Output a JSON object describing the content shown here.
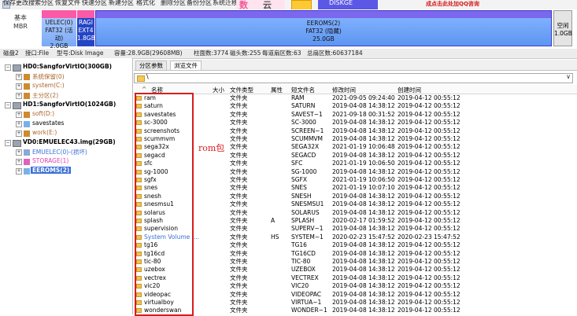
{
  "toolbar": {
    "items": [
      "保存更改",
      "搜索分区",
      "恢复文件",
      "快速分区",
      "新建分区",
      "格式化",
      "删除分区",
      "备份分区",
      "系统迁移"
    ],
    "banner_text": "数",
    "banner_text2": "云",
    "banner_text3": "DISKGE",
    "ad_text": "成点击此处加QQ咨询"
  },
  "diskmap": {
    "disk_label_1": "基本",
    "disk_label_2": "MBR",
    "partitions": [
      {
        "name": "UELEC(0)",
        "fs": "FAT32 (活动)",
        "size": "2.0GB"
      },
      {
        "name": "RAGI",
        "fs": "EXT4",
        "size": "1.8GB"
      },
      {
        "name": "EEROMS(2)",
        "fs": "FAT32 (隐藏)",
        "size": "25.0GB"
      },
      {
        "name": "空闲",
        "size": "1.0GB"
      }
    ]
  },
  "infobar": {
    "disk": "磁盘2",
    "interface": "接口:File",
    "model": "型号:Disk Image",
    "capacity": "容量:28.9GB(29608MB)",
    "cylinders": "柱面数:3774",
    "heads": "磁头数:255",
    "sectors_per_track": "每道扇区数:63",
    "total_sectors": "总扇区数:60637184"
  },
  "tree": {
    "disks": [
      {
        "label": "HD0:SangforVirtIO(300GB)",
        "parts": [
          "系统保留(0)",
          "system(C:)",
          "主分区(2)"
        ]
      },
      {
        "label": "HD1:SangforVirtIO(1024GB)",
        "parts": [
          "soft(D:)",
          "savestates",
          "work(E:)"
        ]
      },
      {
        "label": "VD0:EMUELEC43.img(29GB)",
        "parts": [
          "EMUELEC(0)-(损坏)",
          "STORAGE(1)",
          "EEROMS(2)"
        ]
      }
    ]
  },
  "tabs": [
    "分区参数",
    "浏览文件"
  ],
  "path": "\\",
  "columns": {
    "name": "名称",
    "size": "大小",
    "type": "文件类型",
    "attr": "属性",
    "short": "短文件名",
    "mtime": "修改时间",
    "ctime": "创建时间"
  },
  "files": [
    {
      "name": "ram",
      "type": "文件夹",
      "attr": "",
      "short": "RAM",
      "mtime": "2021-09-05 09:24:40",
      "ctime": "2019-04-12 00:55:12"
    },
    {
      "name": "saturn",
      "type": "文件夹",
      "attr": "",
      "short": "SATURN",
      "mtime": "2019-04-08 14:38:12",
      "ctime": "2019-04-12 00:55:12"
    },
    {
      "name": "savestates",
      "type": "文件夹",
      "attr": "",
      "short": "SAVEST~1",
      "mtime": "2021-09-18 00:31:52",
      "ctime": "2019-04-12 00:55:12"
    },
    {
      "name": "sc-3000",
      "type": "文件夹",
      "attr": "",
      "short": "SC-3000",
      "mtime": "2019-04-08 14:38:12",
      "ctime": "2019-04-12 00:55:12"
    },
    {
      "name": "screenshots",
      "type": "文件夹",
      "attr": "",
      "short": "SCREEN~1",
      "mtime": "2019-04-08 14:38:12",
      "ctime": "2019-04-12 00:55:12"
    },
    {
      "name": "scummvm",
      "type": "文件夹",
      "attr": "",
      "short": "SCUMMVM",
      "mtime": "2019-04-08 14:38:12",
      "ctime": "2019-04-12 00:55:12"
    },
    {
      "name": "sega32x",
      "type": "文件夹",
      "attr": "",
      "short": "SEGA32X",
      "mtime": "2021-01-19 10:06:48",
      "ctime": "2019-04-12 00:55:12"
    },
    {
      "name": "segacd",
      "type": "文件夹",
      "attr": "",
      "short": "SEGACD",
      "mtime": "2019-04-08 14:38:12",
      "ctime": "2019-04-12 00:55:12"
    },
    {
      "name": "sfc",
      "type": "文件夹",
      "attr": "",
      "short": "SFC",
      "mtime": "2021-01-19 10:06:50",
      "ctime": "2019-04-12 00:55:12"
    },
    {
      "name": "sg-1000",
      "type": "文件夹",
      "attr": "",
      "short": "SG-1000",
      "mtime": "2019-04-08 14:38:12",
      "ctime": "2019-04-12 00:55:12"
    },
    {
      "name": "sgfx",
      "type": "文件夹",
      "attr": "",
      "short": "SGFX",
      "mtime": "2021-01-19 10:06:50",
      "ctime": "2019-04-12 00:55:12"
    },
    {
      "name": "snes",
      "type": "文件夹",
      "attr": "",
      "short": "SNES",
      "mtime": "2021-01-19 10:07:10",
      "ctime": "2019-04-12 00:55:12"
    },
    {
      "name": "snesh",
      "type": "文件夹",
      "attr": "",
      "short": "SNESH",
      "mtime": "2019-04-08 14:38:12",
      "ctime": "2019-04-12 00:55:12"
    },
    {
      "name": "snesmsu1",
      "type": "文件夹",
      "attr": "",
      "short": "SNESMSU1",
      "mtime": "2019-04-08 14:38:12",
      "ctime": "2019-04-12 00:55:12"
    },
    {
      "name": "solarus",
      "type": "文件夹",
      "attr": "",
      "short": "SOLARUS",
      "mtime": "2019-04-08 14:38:12",
      "ctime": "2019-04-12 00:55:12"
    },
    {
      "name": "splash",
      "type": "文件夹",
      "attr": "A",
      "short": "SPLASH",
      "mtime": "2020-02-17 01:59:52",
      "ctime": "2019-04-12 00:55:12"
    },
    {
      "name": "supervision",
      "type": "文件夹",
      "attr": "",
      "short": "SUPERV~1",
      "mtime": "2019-04-08 14:38:12",
      "ctime": "2019-04-12 00:55:12"
    },
    {
      "name": "System Volume I...",
      "type": "文件夹",
      "attr": "HS",
      "short": "SYSTEM~1",
      "mtime": "2020-02-23 15:47:52",
      "ctime": "2020-02-23 15:47:52"
    },
    {
      "name": "tg16",
      "type": "文件夹",
      "attr": "",
      "short": "TG16",
      "mtime": "2019-04-08 14:38:12",
      "ctime": "2019-04-12 00:55:12"
    },
    {
      "name": "tg16cd",
      "type": "文件夹",
      "attr": "",
      "short": "TG16CD",
      "mtime": "2019-04-08 14:38:12",
      "ctime": "2019-04-12 00:55:12"
    },
    {
      "name": "tic-80",
      "type": "文件夹",
      "attr": "",
      "short": "TIC-80",
      "mtime": "2019-04-08 14:38:12",
      "ctime": "2019-04-12 00:55:12"
    },
    {
      "name": "uzebox",
      "type": "文件夹",
      "attr": "",
      "short": "UZEBOX",
      "mtime": "2019-04-08 14:38:12",
      "ctime": "2019-04-12 00:55:12"
    },
    {
      "name": "vectrex",
      "type": "文件夹",
      "attr": "",
      "short": "VECTREX",
      "mtime": "2019-04-08 14:38:12",
      "ctime": "2019-04-12 00:55:12"
    },
    {
      "name": "vic20",
      "type": "文件夹",
      "attr": "",
      "short": "VIC20",
      "mtime": "2019-04-08 14:38:12",
      "ctime": "2019-04-12 00:55:12"
    },
    {
      "name": "videopac",
      "type": "文件夹",
      "attr": "",
      "short": "VIDEOPAC",
      "mtime": "2019-04-08 14:38:12",
      "ctime": "2019-04-12 00:55:12"
    },
    {
      "name": "virtualboy",
      "type": "文件夹",
      "attr": "",
      "short": "VIRTUA~1",
      "mtime": "2019-04-08 14:38:12",
      "ctime": "2019-04-12 00:55:12"
    },
    {
      "name": "wonderswan",
      "type": "文件夹",
      "attr": "",
      "short": "WONDER~1",
      "mtime": "2019-04-08 14:38:12",
      "ctime": "2019-04-12 00:55:12"
    }
  ],
  "annotation": "rom包",
  "colors": {
    "selection": "#3a6fd8",
    "annotation": "#d81c1c",
    "partition_cap": "#fa5aa6"
  }
}
